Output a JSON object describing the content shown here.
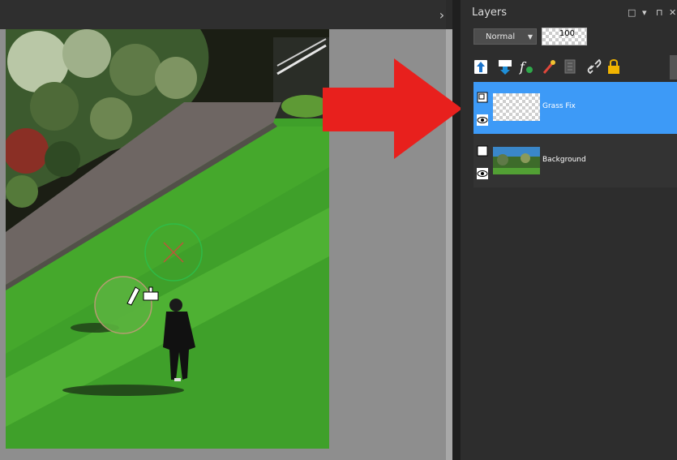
{
  "panel": {
    "title": "Layers",
    "window_controls": [
      "□",
      "▾",
      "⊓",
      "✕"
    ],
    "blend_mode": "Normal",
    "opacity": "100",
    "toolbar_icons": [
      "new-raster-layer-icon",
      "new-vector-layer-icon",
      "layer-style-icon",
      "new-mask-icon",
      "group-icon",
      "link-icon",
      "lock-icon"
    ]
  },
  "layers": [
    {
      "name": "Grass Fix",
      "selected": true,
      "visible": true
    },
    {
      "name": "Background",
      "selected": false,
      "visible": true
    }
  ],
  "canvas": {
    "collapse_glyph": "›",
    "tool_cursor": "clone-brush"
  },
  "colors": {
    "selection": "#3d9af7",
    "arrow": "#e8201d",
    "panel": "#2d2d2d",
    "grass": "#52b533"
  }
}
